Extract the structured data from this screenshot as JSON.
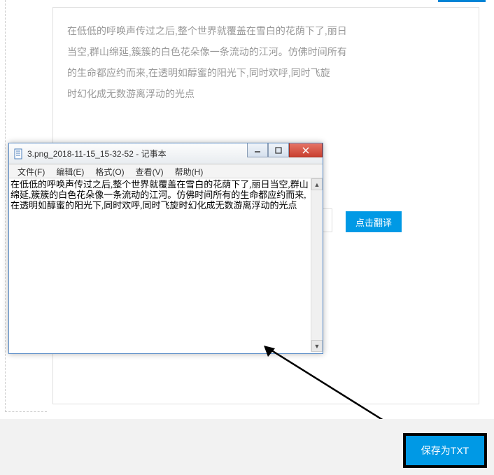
{
  "content": {
    "line1": "在低低的呼唤声传过之后,整个世界就覆盖在雪白的花荫下了,丽日",
    "line2": "当空,群山绵延,簇簇的白色花朵像一条流动的江河。仿佛时间所有",
    "line3": "的生命都应约而来,在透明如醇蜜的阳光下,同时欢呼,同时飞旋",
    "line4": "时幻化成无数游离浮动的光点"
  },
  "buttons": {
    "translate": "点击翻译",
    "save_txt": "保存为TXT"
  },
  "notepad": {
    "title": "3.png_2018-11-15_15-32-52 - 记事本",
    "menu": {
      "file": "文件(F)",
      "edit": "编辑(E)",
      "format": "格式(O)",
      "view": "查看(V)",
      "help": "帮助(H)"
    },
    "body": "在低低的呼唤声传过之后,整个世界就覆盖在雪白的花荫下了,丽日当空,群山绵延,簇簇的白色花朵像一条流动的江河。仿佛时间所有的生命都应约而来,在透明如醇蜜的阳光下,同时欢呼,同时飞旋时幻化成无数游离浮动的光点"
  }
}
